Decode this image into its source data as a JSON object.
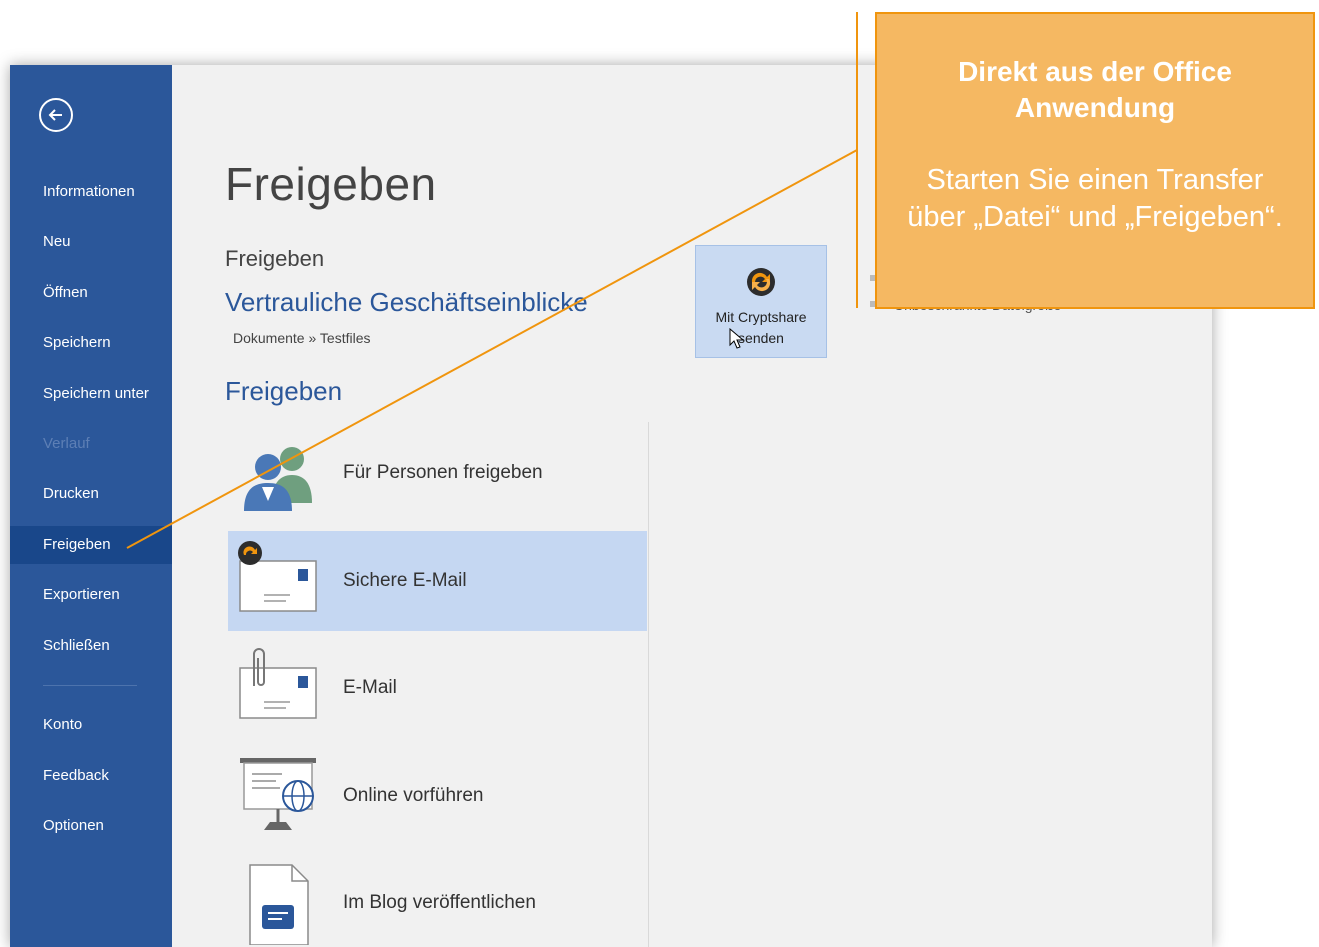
{
  "sidebar": {
    "items": [
      {
        "label": "Informationen",
        "state": "normal"
      },
      {
        "label": "Neu",
        "state": "normal"
      },
      {
        "label": "Öffnen",
        "state": "normal"
      },
      {
        "label": "Speichern",
        "state": "normal"
      },
      {
        "label": "Speichern unter",
        "state": "normal"
      },
      {
        "label": "Verlauf",
        "state": "disabled"
      },
      {
        "label": "Drucken",
        "state": "normal"
      },
      {
        "label": "Freigeben",
        "state": "active"
      },
      {
        "label": "Exportieren",
        "state": "normal"
      },
      {
        "label": "Schließen",
        "state": "normal"
      },
      {
        "label": "Konto",
        "state": "normal"
      },
      {
        "label": "Feedback",
        "state": "normal"
      },
      {
        "label": "Optionen",
        "state": "normal"
      }
    ]
  },
  "main": {
    "title": "Freigeben",
    "doc_heading": "Freigeben",
    "doc_name": "Vertrauliche Geschäftseinblicke",
    "doc_path": "Dokumente » Testfiles",
    "section_heading": "Freigeben",
    "share_options": [
      {
        "label": "Für Personen freigeben",
        "icon": "people-icon"
      },
      {
        "label": "Sichere E-Mail",
        "icon": "secure-email-icon",
        "selected": true
      },
      {
        "label": "E-Mail",
        "icon": "email-attachment-icon"
      },
      {
        "label": "Online vorführen",
        "icon": "present-online-icon"
      },
      {
        "label": "Im Blog veröffentlichen",
        "icon": "blog-post-icon"
      }
    ],
    "cryptshare_button": "Mit Cryptshare senden",
    "partial_text": "Unbeschränkte Dateigröße"
  },
  "callout": {
    "title": "Direkt aus der Office Anwendung",
    "body": "Starten Sie einen Transfer über „Datei“ und „Freigeben“."
  },
  "colors": {
    "sidebar_bg": "#2b579a",
    "sidebar_active": "#19478a",
    "selected_item": "#c5d7f2",
    "callout_fill": "#f5b862",
    "callout_border": "#f0950e",
    "accent_text": "#2b579a"
  }
}
